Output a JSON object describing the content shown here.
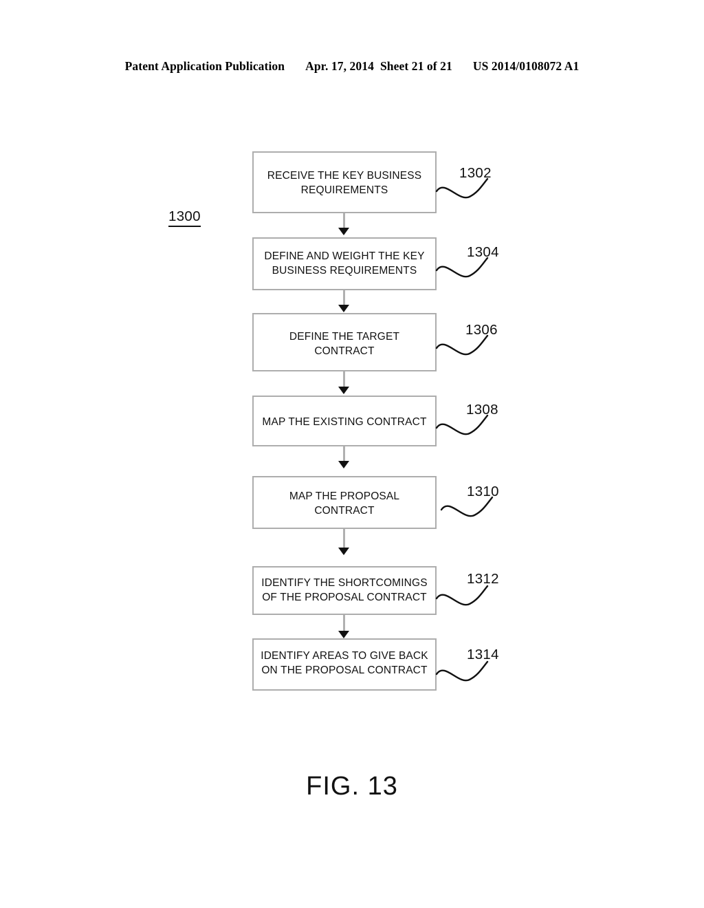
{
  "header": {
    "publication": "Patent Application Publication",
    "date": "Apr. 17, 2014",
    "sheet": "Sheet 21 of 21",
    "number": "US 2014/0108072 A1"
  },
  "diagram": {
    "id_label": "1300",
    "caption": "FIG. 13",
    "steps": [
      {
        "ref": "1302",
        "line1": "RECEIVE THE KEY BUSINESS",
        "line2": "REQUIREMENTS"
      },
      {
        "ref": "1304",
        "line1": "DEFINE AND WEIGHT THE KEY",
        "line2": "BUSINESS REQUIREMENTS"
      },
      {
        "ref": "1306",
        "line1": "DEFINE THE TARGET",
        "line2": "CONTRACT"
      },
      {
        "ref": "1308",
        "line1": "MAP THE EXISTING CONTRACT",
        "line2": ""
      },
      {
        "ref": "1310",
        "line1": "MAP THE PROPOSAL",
        "line2": "CONTRACT"
      },
      {
        "ref": "1312",
        "line1": "IDENTIFY THE SHORTCOMINGS",
        "line2": "OF THE PROPOSAL CONTRACT"
      },
      {
        "ref": "1314",
        "line1": "IDENTIFY AREAS TO GIVE BACK",
        "line2": "ON THE PROPOSAL CONTRACT"
      }
    ]
  }
}
